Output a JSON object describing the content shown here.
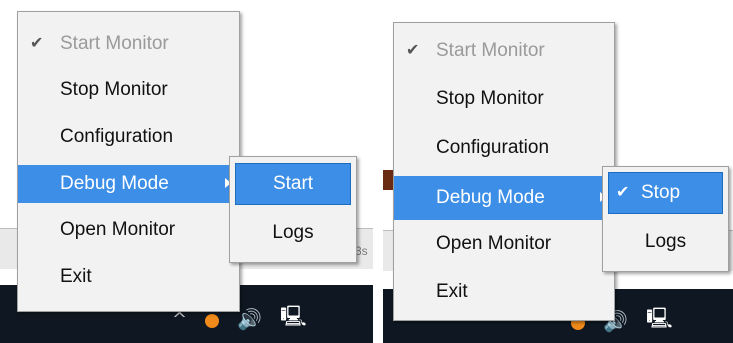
{
  "menu": {
    "items": [
      {
        "label": "Start Monitor",
        "checked": true,
        "disabled": true
      },
      {
        "label": "Stop Monitor"
      },
      {
        "label": "Configuration"
      },
      {
        "label": "Debug Mode",
        "has_submenu": true,
        "highlighted": true
      },
      {
        "label": "Open Monitor"
      },
      {
        "label": "Exit"
      }
    ]
  },
  "submenu_left": {
    "items": [
      {
        "label": "Start",
        "highlighted": true
      },
      {
        "label": "Logs"
      }
    ]
  },
  "submenu_right": {
    "items": [
      {
        "label": "Stop",
        "checked": true,
        "highlighted": true
      },
      {
        "label": "Logs"
      }
    ]
  },
  "backdrop": {
    "partial_text_left": "3s",
    "partial_text_right": "3"
  },
  "tray": {
    "icons": [
      "chevron-up-icon",
      "app-icon",
      "speaker-icon",
      "network-icon"
    ]
  },
  "colors": {
    "highlight": "#3d8ee6",
    "menu_bg": "#f2f2f2",
    "taskbar": "#0f1722"
  }
}
